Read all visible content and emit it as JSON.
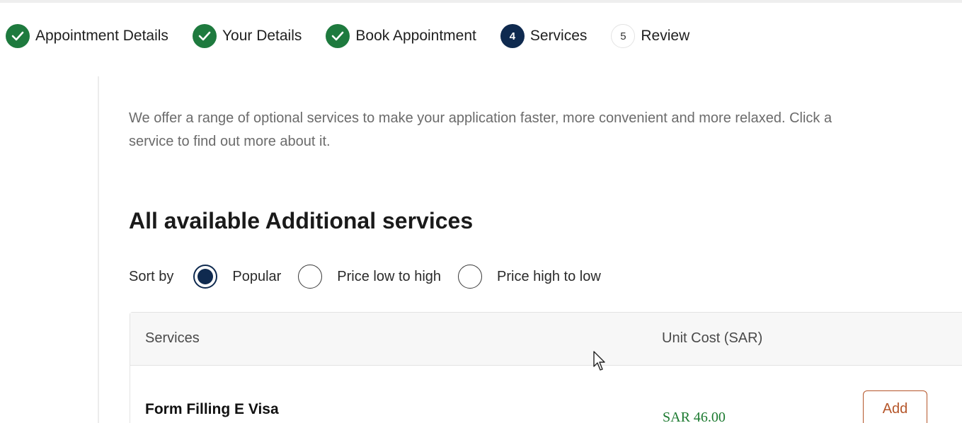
{
  "stepper": {
    "steps": [
      {
        "label": "Appointment Details",
        "status": "done",
        "badge": ""
      },
      {
        "label": "Your Details",
        "status": "done",
        "badge": ""
      },
      {
        "label": "Book Appointment",
        "status": "done",
        "badge": ""
      },
      {
        "label": "Services",
        "status": "active",
        "badge": "4"
      },
      {
        "label": "Review",
        "status": "todo",
        "badge": "5"
      }
    ]
  },
  "intro": {
    "line1": "We offer a range of optional services to make your application faster, more convenient and more relaxed. Click a",
    "line2": "service to find out more about it."
  },
  "section": {
    "title": "All available Additional services"
  },
  "sort": {
    "label": "Sort by",
    "options": [
      {
        "label": "Popular",
        "checked": true
      },
      {
        "label": "Price low to high",
        "checked": false
      },
      {
        "label": "Price high to low",
        "checked": false
      }
    ]
  },
  "table": {
    "headers": [
      "Services",
      "Unit Cost (SAR)"
    ],
    "rows": [
      {
        "service": "Form Filling E Visa",
        "cost": "SAR 46.00",
        "action": "Add"
      }
    ]
  },
  "colors": {
    "done": "#1e7a3e",
    "active": "#0f2a4f",
    "price": "#1c7a30",
    "add_button": "#b5562a"
  },
  "icons": {
    "done_step": "check-icon",
    "pointer": "mouse-cursor-icon"
  }
}
